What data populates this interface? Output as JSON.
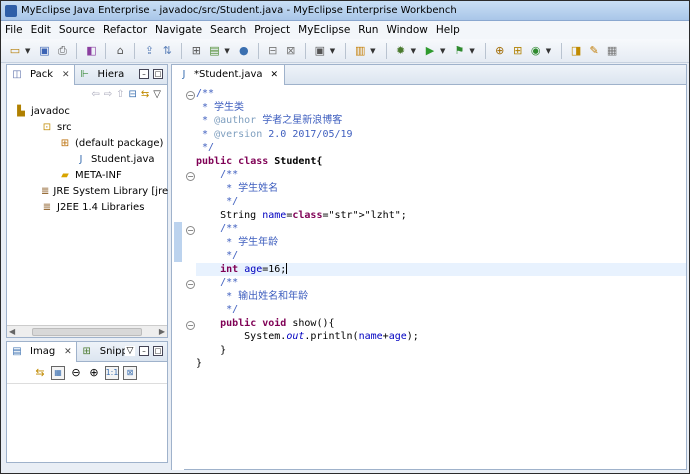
{
  "window": {
    "title": "MyEclipse Java Enterprise - javadoc/src/Student.java - MyEclipse Enterprise Workbench"
  },
  "menu": [
    "File",
    "Edit",
    "Source",
    "Refactor",
    "Navigate",
    "Search",
    "Project",
    "MyEclipse",
    "Run",
    "Window",
    "Help"
  ],
  "package_view": {
    "tabs": [
      {
        "label": "Pack",
        "icon": "package-explorer-icon"
      },
      {
        "label": "Hiera",
        "icon": "hierarchy-icon"
      }
    ],
    "tree": [
      {
        "label": "javadoc",
        "icon": "project-icon",
        "depth": 0
      },
      {
        "label": "src",
        "icon": "source-folder-icon",
        "depth": 1
      },
      {
        "label": "(default package)",
        "icon": "package-icon",
        "depth": 2
      },
      {
        "label": "Student.java",
        "icon": "java-file-icon",
        "depth": 3
      },
      {
        "label": "META-INF",
        "icon": "folder-icon",
        "depth": 2
      },
      {
        "label": "JRE System Library [jre",
        "icon": "library-icon",
        "depth": 1
      },
      {
        "label": "J2EE 1.4 Libraries",
        "icon": "library-icon",
        "depth": 1
      }
    ]
  },
  "image_view": {
    "tabs": [
      {
        "label": "Imag",
        "icon": "image-view-icon"
      },
      {
        "label": "Snipp",
        "icon": "snippets-icon"
      }
    ]
  },
  "editor": {
    "tab_label": "*Student.java",
    "code": [
      "/**",
      " * 学生类",
      " * @author 学者之星新浪博客",
      " * @version 2.0 2017/05/19",
      " */",
      "public class Student{",
      "    /**",
      "     * 学生姓名",
      "     */",
      "    String name=\"lzht\";",
      "    /**",
      "     * 学生年龄",
      "     */",
      "    int age=16;",
      "    /**",
      "     * 输出姓名和年龄",
      "     */",
      "    public void show(){",
      "        System.out.println(name+age);",
      "    }",
      "}"
    ]
  },
  "colors": {
    "keyword": "#7f0055",
    "comment": "#3f5fbf",
    "string": "#2a00ff",
    "field": "#0000c0"
  }
}
